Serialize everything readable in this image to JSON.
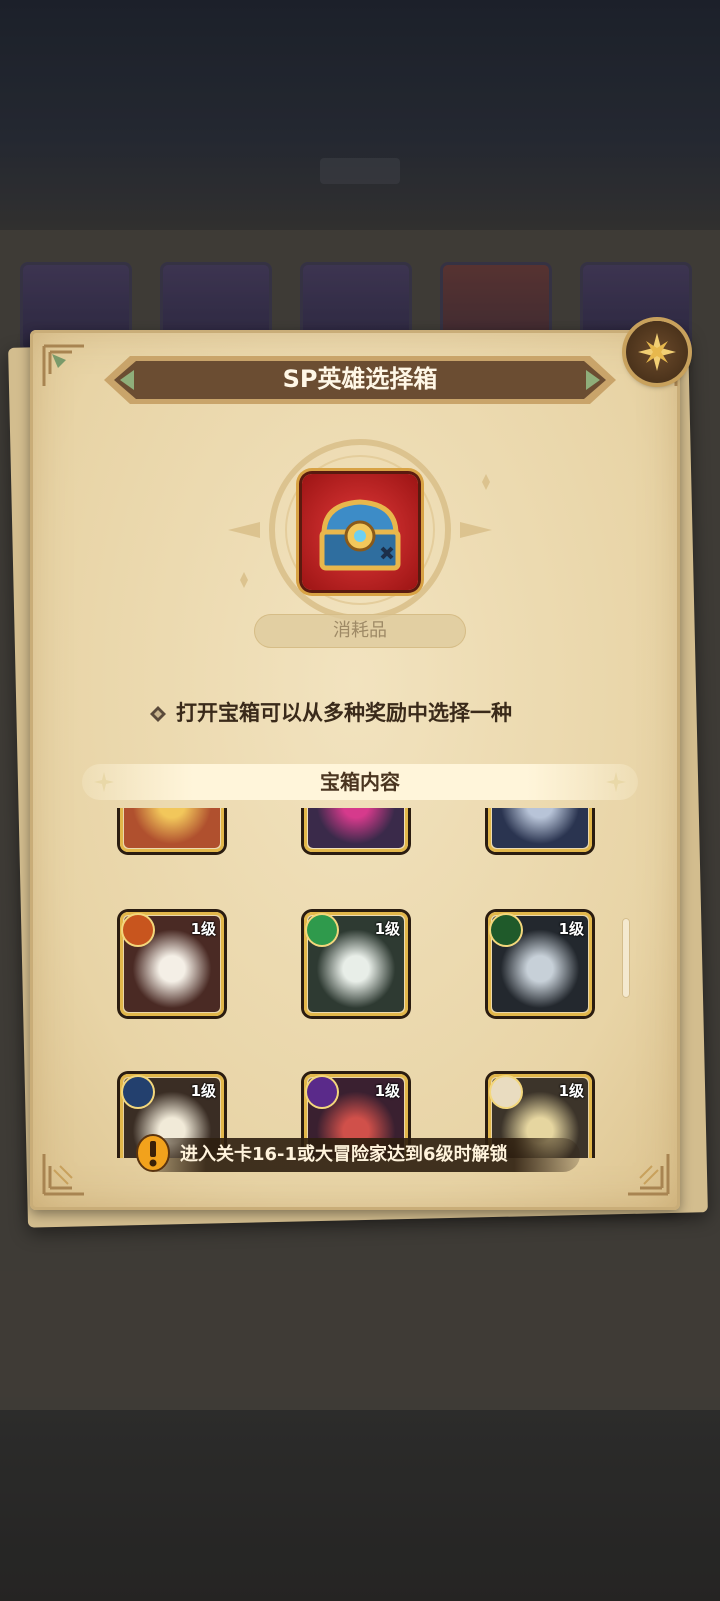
{
  "popup": {
    "title": "SP英雄选择箱",
    "category": "消耗品",
    "description": "打开宝箱可以从多种奖励中选择一种",
    "contents_header": "宝箱内容",
    "unlock_notice": "进入关卡16-1或大冒险家达到6级时解锁"
  },
  "heroes": [
    {
      "level": "",
      "faction": "none",
      "portrait_color": "#b0502e",
      "accent": "#f2c75b"
    },
    {
      "level": "",
      "faction": "none",
      "portrait_color": "#3a2a4a",
      "accent": "#d63a8c"
    },
    {
      "level": "",
      "faction": "none",
      "portrait_color": "#2a3450",
      "accent": "#b8c4d8"
    },
    {
      "level": "1级",
      "faction": "lightbearer",
      "portrait_color": "#4a2a24",
      "accent": "#f4efe6"
    },
    {
      "level": "1级",
      "faction": "wilder",
      "portrait_color": "#2e3a32",
      "accent": "#e8eee8"
    },
    {
      "level": "1级",
      "faction": "graveborn",
      "portrait_color": "#23282e",
      "accent": "#c7d0d8"
    },
    {
      "level": "1级",
      "faction": "celestial",
      "portrait_color": "#3a2d24",
      "accent": "#f1ead8"
    },
    {
      "level": "1级",
      "faction": "hypogean",
      "portrait_color": "#3a2030",
      "accent": "#d0504a"
    },
    {
      "level": "1级",
      "faction": "dimensional",
      "portrait_color": "#3c342a",
      "accent": "#e6d6a0"
    }
  ],
  "colors": {
    "parchment": "#ecd9ae",
    "banner": "#6b4d32",
    "gold": "#e2b74a",
    "chest_bg": "#c92323"
  }
}
